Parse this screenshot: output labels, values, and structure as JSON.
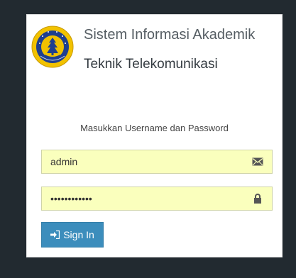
{
  "header": {
    "title": "Sistem Informasi Akademik",
    "subtitle": "Teknik Telekomunikasi",
    "logo_icon": "university-seal-icon"
  },
  "login": {
    "prompt": "Masukkan Username dan Password",
    "username": {
      "value": "admin",
      "icon": "envelope-icon"
    },
    "password": {
      "value": "••••••••••••",
      "icon": "lock-icon"
    },
    "signin_label": "Sign In",
    "signin_icon": "sign-in-icon"
  },
  "colors": {
    "background": "#222a30",
    "card": "#ffffff",
    "field_fill": "#faffbd",
    "button": "#3c8dbc"
  }
}
